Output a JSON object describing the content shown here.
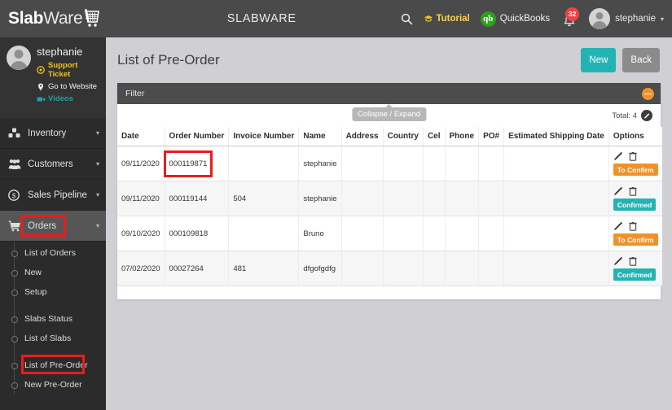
{
  "topbar": {
    "logo_bold": "Slab",
    "logo_light": "Ware",
    "logo_icon": "shopping-cart-icon",
    "center_title": "SLABWARE",
    "search_icon": "search-icon",
    "tutorial_label": "Tutorial",
    "tutorial_icon": "graduation-cap-icon",
    "quickbooks_label": "QuickBooks",
    "quickbooks_mark": "qb",
    "bell_icon": "bell-icon",
    "notification_count": "32",
    "user_name": "stephanie",
    "user_caret": "▾"
  },
  "sidebar": {
    "profile": {
      "name": "stephanie",
      "support_ticket": "Support Ticket",
      "go_to_website": "Go to Website",
      "videos": "Videos"
    },
    "menu": [
      {
        "label": "Inventory",
        "icon": "cubes-icon",
        "caret": "▾",
        "active": false
      },
      {
        "label": "Customers",
        "icon": "users-icon",
        "caret": "▾",
        "active": false
      },
      {
        "label": "Sales Pipeline",
        "icon": "dollar-circle-icon",
        "caret": "▾",
        "active": false
      },
      {
        "label": "Orders",
        "icon": "shopping-cart-icon",
        "caret": "▾",
        "active": true
      }
    ],
    "submenu": [
      "List of Orders",
      "New",
      "Setup",
      "Slabs Status",
      "List of Slabs",
      "List of Pre-Order",
      "New Pre-Order"
    ]
  },
  "main": {
    "page_title": "List of Pre-Order",
    "new_button": "New",
    "back_button": "Back",
    "filter_label": "Filter",
    "filter_toggle_icon": "minus-circle-icon",
    "tooltip": "Collapse / Expand",
    "total_label": "Total: 4",
    "total_icon": "pencil-circle-icon",
    "columns": [
      "Date",
      "Order Number",
      "Invoice Number",
      "Name",
      "Address",
      "Country",
      "Cel",
      "Phone",
      "PO#",
      "Estimated Shipping Date",
      "Options"
    ],
    "rows": [
      {
        "date": "09/11/2020",
        "order_number": "000119871",
        "invoice_number": "",
        "name": "stephanie",
        "address": "",
        "country": "",
        "cel": "",
        "phone": "",
        "po": "",
        "shipping_date": "",
        "status": "To Confirm",
        "status_type": "toconfirm",
        "edit_icon": "pencil-icon",
        "delete_icon": "trash-icon"
      },
      {
        "date": "09/11/2020",
        "order_number": "000119144",
        "invoice_number": "504",
        "name": "stephanie",
        "address": "",
        "country": "",
        "cel": "",
        "phone": "",
        "po": "",
        "shipping_date": "",
        "status": "Confirmed",
        "status_type": "confirmed",
        "edit_icon": "pencil-icon",
        "delete_icon": "trash-icon"
      },
      {
        "date": "09/10/2020",
        "order_number": "000109818",
        "invoice_number": "",
        "name": "Bruno",
        "address": "",
        "country": "",
        "cel": "",
        "phone": "",
        "po": "",
        "shipping_date": "",
        "status": "To Confirm",
        "status_type": "toconfirm",
        "edit_icon": "pencil-icon",
        "delete_icon": "trash-icon"
      },
      {
        "date": "07/02/2020",
        "order_number": "00027264",
        "invoice_number": "481",
        "name": "dfgofgdfg",
        "address": "",
        "country": "",
        "cel": "",
        "phone": "",
        "po": "",
        "shipping_date": "",
        "status": "Confirmed",
        "status_type": "confirmed",
        "edit_icon": "pencil-icon",
        "delete_icon": "trash-icon"
      }
    ]
  },
  "colors": {
    "teal": "#23b3b3",
    "orange": "#f0922b",
    "highlight_red": "#e81d1d",
    "sidebar_dark": "#2b2b2b",
    "topbar": "#4a4a4a",
    "yellow": "#f0c419",
    "quickbooks_green": "#2CA01C",
    "badge_red": "#ef4444"
  }
}
